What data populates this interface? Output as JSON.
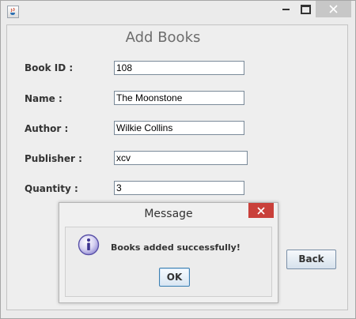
{
  "window": {
    "title": ""
  },
  "form": {
    "heading": "Add Books",
    "fields": [
      {
        "label": "Book ID :",
        "value": "108"
      },
      {
        "label": "Name :",
        "value": "The Moonstone"
      },
      {
        "label": "Author :",
        "value": "Wilkie Collins"
      },
      {
        "label": "Publisher :",
        "value": "xcv"
      },
      {
        "label": "Quantity :",
        "value": "3"
      }
    ],
    "back_label": "Back"
  },
  "dialog": {
    "title": "Message",
    "message": "Books added successfully!",
    "ok_label": "OK",
    "icon": "info-icon"
  },
  "colors": {
    "close_red": "#c9403a",
    "accent_blue": "#3c7fb1"
  }
}
